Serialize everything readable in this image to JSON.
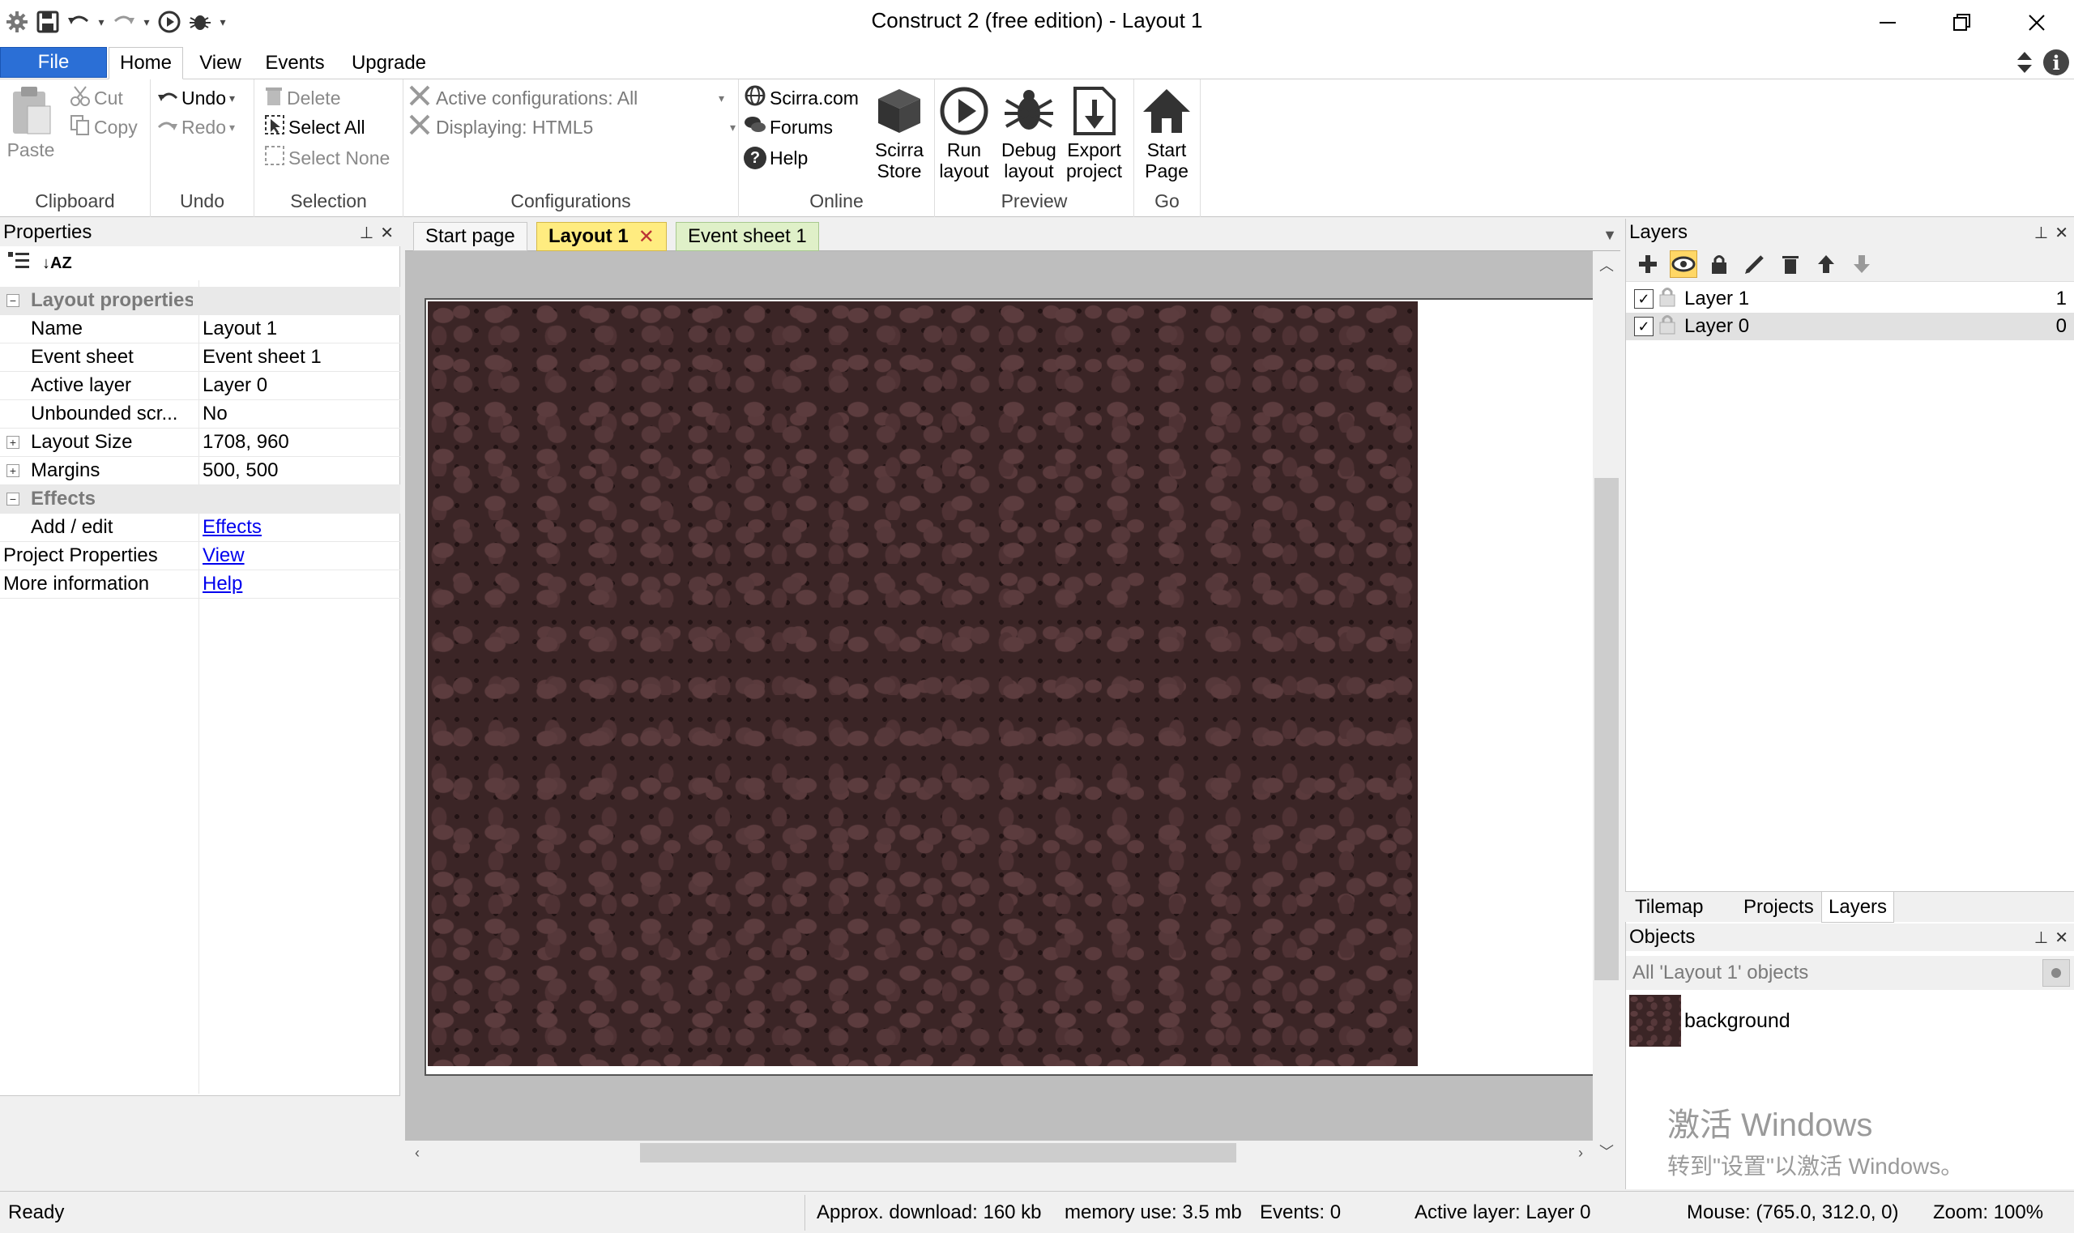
{
  "window": {
    "title": "Construct 2  (free edition) - Layout 1",
    "controls": [
      "minimize",
      "restore",
      "close"
    ]
  },
  "ribbon_tabs": {
    "file": "File",
    "tabs": [
      "Home",
      "View",
      "Events",
      "Upgrade"
    ],
    "active": "Home"
  },
  "ribbon": {
    "clipboard": {
      "paste": "Paste",
      "cut": "Cut",
      "copy": "Copy",
      "label": "Clipboard"
    },
    "undo": {
      "undo": "Undo",
      "redo": "Redo",
      "label": "Undo"
    },
    "selection": {
      "delete": "Delete",
      "select_all": "Select All",
      "select_none": "Select None",
      "label": "Selection"
    },
    "configurations": {
      "active": "Active configurations: All",
      "displaying": "Displaying: HTML5",
      "label": "Configurations"
    },
    "online": {
      "scirra": "Scirra.com",
      "forums": "Forums",
      "help": "Help",
      "store_line1": "Scirra",
      "store_line2": "Store",
      "label": "Online"
    },
    "preview": {
      "run_line1": "Run",
      "run_line2": "layout",
      "debug_line1": "Debug",
      "debug_line2": "layout",
      "export_line1": "Export",
      "export_line2": "project",
      "label": "Preview"
    },
    "go": {
      "start_line1": "Start",
      "start_line2": "Page",
      "label": "Go"
    }
  },
  "properties": {
    "title": "Properties",
    "category_layout": "Layout properties",
    "rows": [
      {
        "key": "Name",
        "value": "Layout 1"
      },
      {
        "key": "Event sheet",
        "value": "Event sheet 1"
      },
      {
        "key": "Active layer",
        "value": "Layer 0"
      },
      {
        "key": "Unbounded scr...",
        "value": "No"
      },
      {
        "key": "Layout Size",
        "value": "1708, 960"
      },
      {
        "key": "Margins",
        "value": "500, 500"
      }
    ],
    "category_effects": "Effects",
    "effects_row": {
      "key": "Add / edit",
      "value": "Effects"
    },
    "project_row": {
      "key": "Project Properties",
      "value": "View"
    },
    "info_row": {
      "key": "More information",
      "value": "Help"
    }
  },
  "document_tabs": {
    "start": "Start page",
    "layout": "Layout 1",
    "event": "Event sheet 1"
  },
  "layers": {
    "title": "Layers",
    "items": [
      {
        "name": "Layer 1",
        "number": "1",
        "visible": true
      },
      {
        "name": "Layer 0",
        "number": "0",
        "visible": true
      }
    ],
    "bottom_tabs": [
      "Tilemap",
      "Projects",
      "Layers"
    ],
    "active_bottom_tab": "Layers"
  },
  "objects": {
    "title": "Objects",
    "filter": "All 'Layout 1' objects",
    "items": [
      {
        "name": "background"
      }
    ]
  },
  "watermark": {
    "line1": "激活 Windows",
    "line2": "转到\"设置\"以激活 Windows。"
  },
  "status": {
    "ready": "Ready",
    "download": "Approx. download: 160 kb",
    "memory": "memory use: 3.5 mb",
    "events": "Events: 0",
    "active_layer": "Active layer: Layer 0",
    "mouse": "Mouse: (765.0, 312.0, 0)",
    "zoom": "Zoom: 100%"
  },
  "colors": {
    "file_tab": "#2b6fd6",
    "layout_tab": "#ffec80",
    "event_tab": "#dff0c8",
    "canvas_gray": "#bebebe",
    "link": "#0000ee"
  }
}
